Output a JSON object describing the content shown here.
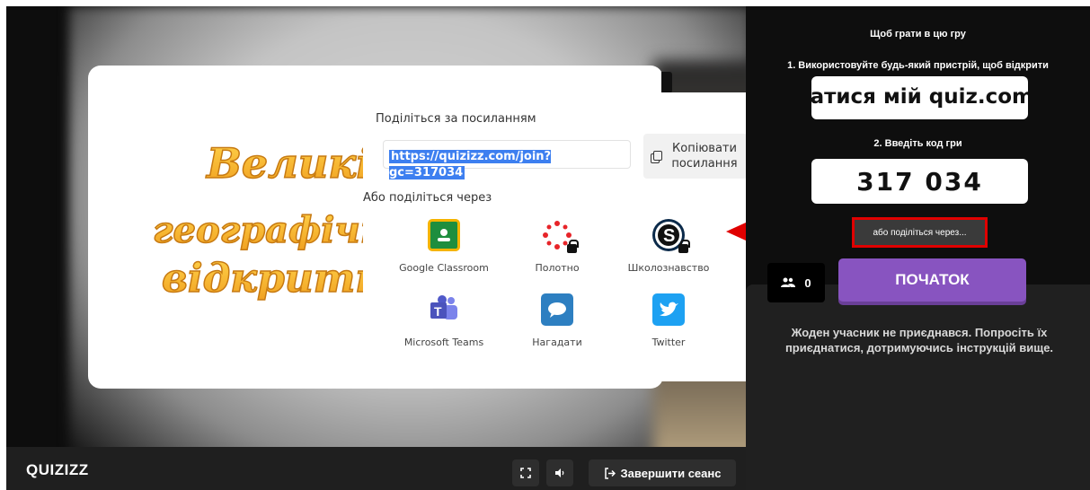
{
  "cover": {
    "title_art": "Великі географічні відкриття"
  },
  "share_panel": {
    "link_title": "Поділіться за посиланням",
    "link_value": "https://quizizz.com/join?gc=317034",
    "copy_label": "Копіювати посилання",
    "or_title": "Або поділіться через",
    "items": [
      {
        "label": "Google Classroom",
        "icon": "google-classroom-icon",
        "color": "#1e8e3e",
        "locked": false
      },
      {
        "label": "Полотно",
        "icon": "canvas-icon",
        "color": "#e72429",
        "locked": true
      },
      {
        "label": "Школознавство",
        "icon": "schoology-icon",
        "color": "#0b2a4a",
        "locked": true
      },
      {
        "label": "Microsoft Teams",
        "icon": "microsoft-teams-icon",
        "color": "#5059c9",
        "locked": false
      },
      {
        "label": "Нагадати",
        "icon": "remind-icon",
        "color": "#2d7fc1",
        "locked": false
      },
      {
        "label": "Twitter",
        "icon": "twitter-icon",
        "color": "#1da1f2",
        "locked": false
      }
    ]
  },
  "sidebar": {
    "heading": "Щоб грати в цю гру",
    "step1": "1. Використовуйте будь-який пристрій, щоб відкрити",
    "join_url": "приєднатися мій quiz.com",
    "step2": "2. Введіть код гри",
    "game_code": "317 034",
    "share_via_label": "або поділіться через...",
    "player_count": "0",
    "start_label": "ПОЧАТОК",
    "empty_message": "Жоден учасник не приєднався. Попросіть їх приєднатися, дотримуючись інструкцій вище."
  },
  "bottom_bar": {
    "logo": "QUIZIZZ",
    "end_session_label": "Завершити сеанс"
  },
  "colors": {
    "accent": "#8854c0",
    "highlight": "#e00000",
    "link_selection": "#3d7ff0"
  }
}
